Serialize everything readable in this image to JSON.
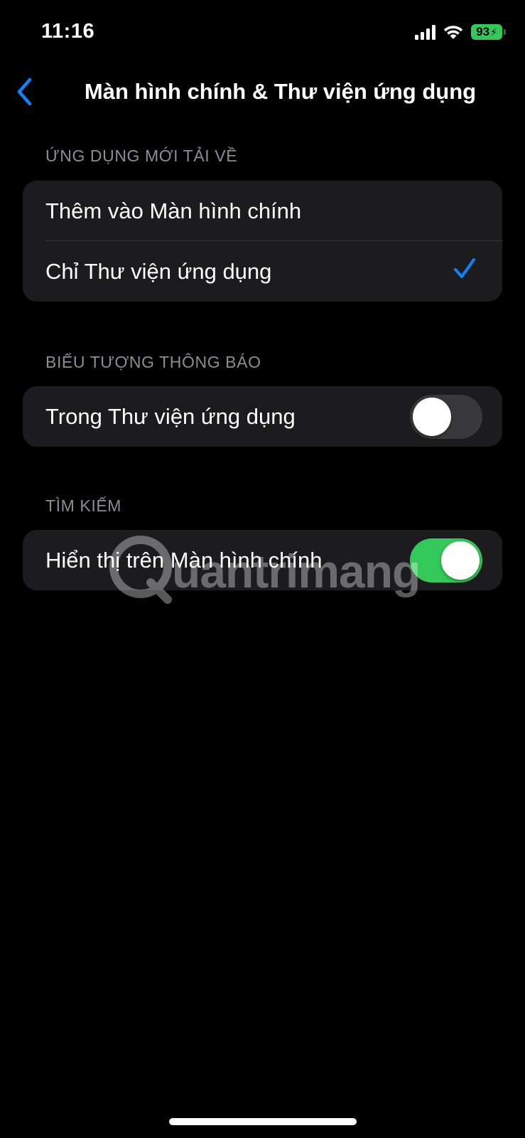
{
  "status_bar": {
    "time": "11:16",
    "battery_level": "93",
    "battery_charging": true,
    "signal_bars": 4,
    "icons": [
      "cellular-signal-icon",
      "wifi-icon",
      "battery-icon"
    ]
  },
  "nav": {
    "back_icon": "chevron-left-icon",
    "title": "Màn hình chính & Thư viện ứng dụng"
  },
  "sections": {
    "new_apps": {
      "header": "ỨNG DỤNG MỚI TẢI VỀ",
      "options": [
        {
          "label": "Thêm vào Màn hình chính",
          "selected": false
        },
        {
          "label": "Chỉ Thư viện ứng dụng",
          "selected": true
        }
      ]
    },
    "badges": {
      "header": "BIỂU TƯỢNG THÔNG BÁO",
      "toggle_label": "Trong Thư viện ứng dụng",
      "toggle_on": false
    },
    "search": {
      "header": "TÌM KIẾM",
      "toggle_label": "Hiển thị trên Màn hình chính",
      "toggle_on": true
    }
  },
  "watermark": {
    "text": "uantrimang"
  },
  "colors": {
    "background": "#000000",
    "group_background": "#1c1c1e",
    "accent_blue": "#0a84ff",
    "toggle_on": "#34c759",
    "toggle_off": "#39393d",
    "secondary_text": "#8d8d93"
  }
}
